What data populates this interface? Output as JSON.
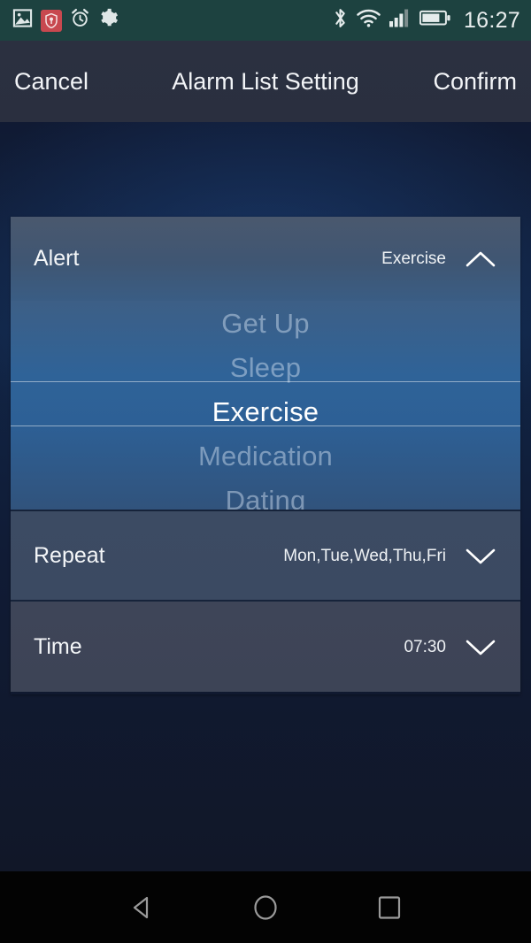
{
  "status_bar": {
    "time": "16:27",
    "background": "#1d4240",
    "left_icons": [
      {
        "name": "gallery-icon"
      },
      {
        "name": "security-shield-icon",
        "color": "#c8484f"
      },
      {
        "name": "alarm-clock-icon"
      },
      {
        "name": "settings-gear-icon"
      }
    ],
    "right_icons": [
      {
        "name": "bluetooth-icon"
      },
      {
        "name": "wifi-icon"
      },
      {
        "name": "cellular-signal-icon",
        "bars_filled": 3,
        "bars_total": 4
      },
      {
        "name": "battery-icon",
        "level_percent": 72
      }
    ]
  },
  "header": {
    "cancel_label": "Cancel",
    "title": "Alarm List Setting",
    "confirm_label": "Confirm"
  },
  "settings": {
    "alert": {
      "label": "Alert",
      "value": "Exercise",
      "expanded": true,
      "chevron": "chevron-up-icon",
      "options": [
        {
          "label": "Get Up",
          "selected": false
        },
        {
          "label": "Sleep",
          "selected": false
        },
        {
          "label": "Exercise",
          "selected": true
        },
        {
          "label": "Medication",
          "selected": false
        },
        {
          "label": "Dating",
          "selected": false
        }
      ]
    },
    "repeat": {
      "label": "Repeat",
      "value": "Mon,Tue,Wed,Thu,Fri",
      "expanded": false,
      "chevron": "chevron-down-icon"
    },
    "time": {
      "label": "Time",
      "value": "07:30",
      "expanded": false,
      "chevron": "chevron-down-icon"
    }
  },
  "nav_bar": {
    "back_label": "Back",
    "home_label": "Home",
    "recents_label": "Recents"
  }
}
